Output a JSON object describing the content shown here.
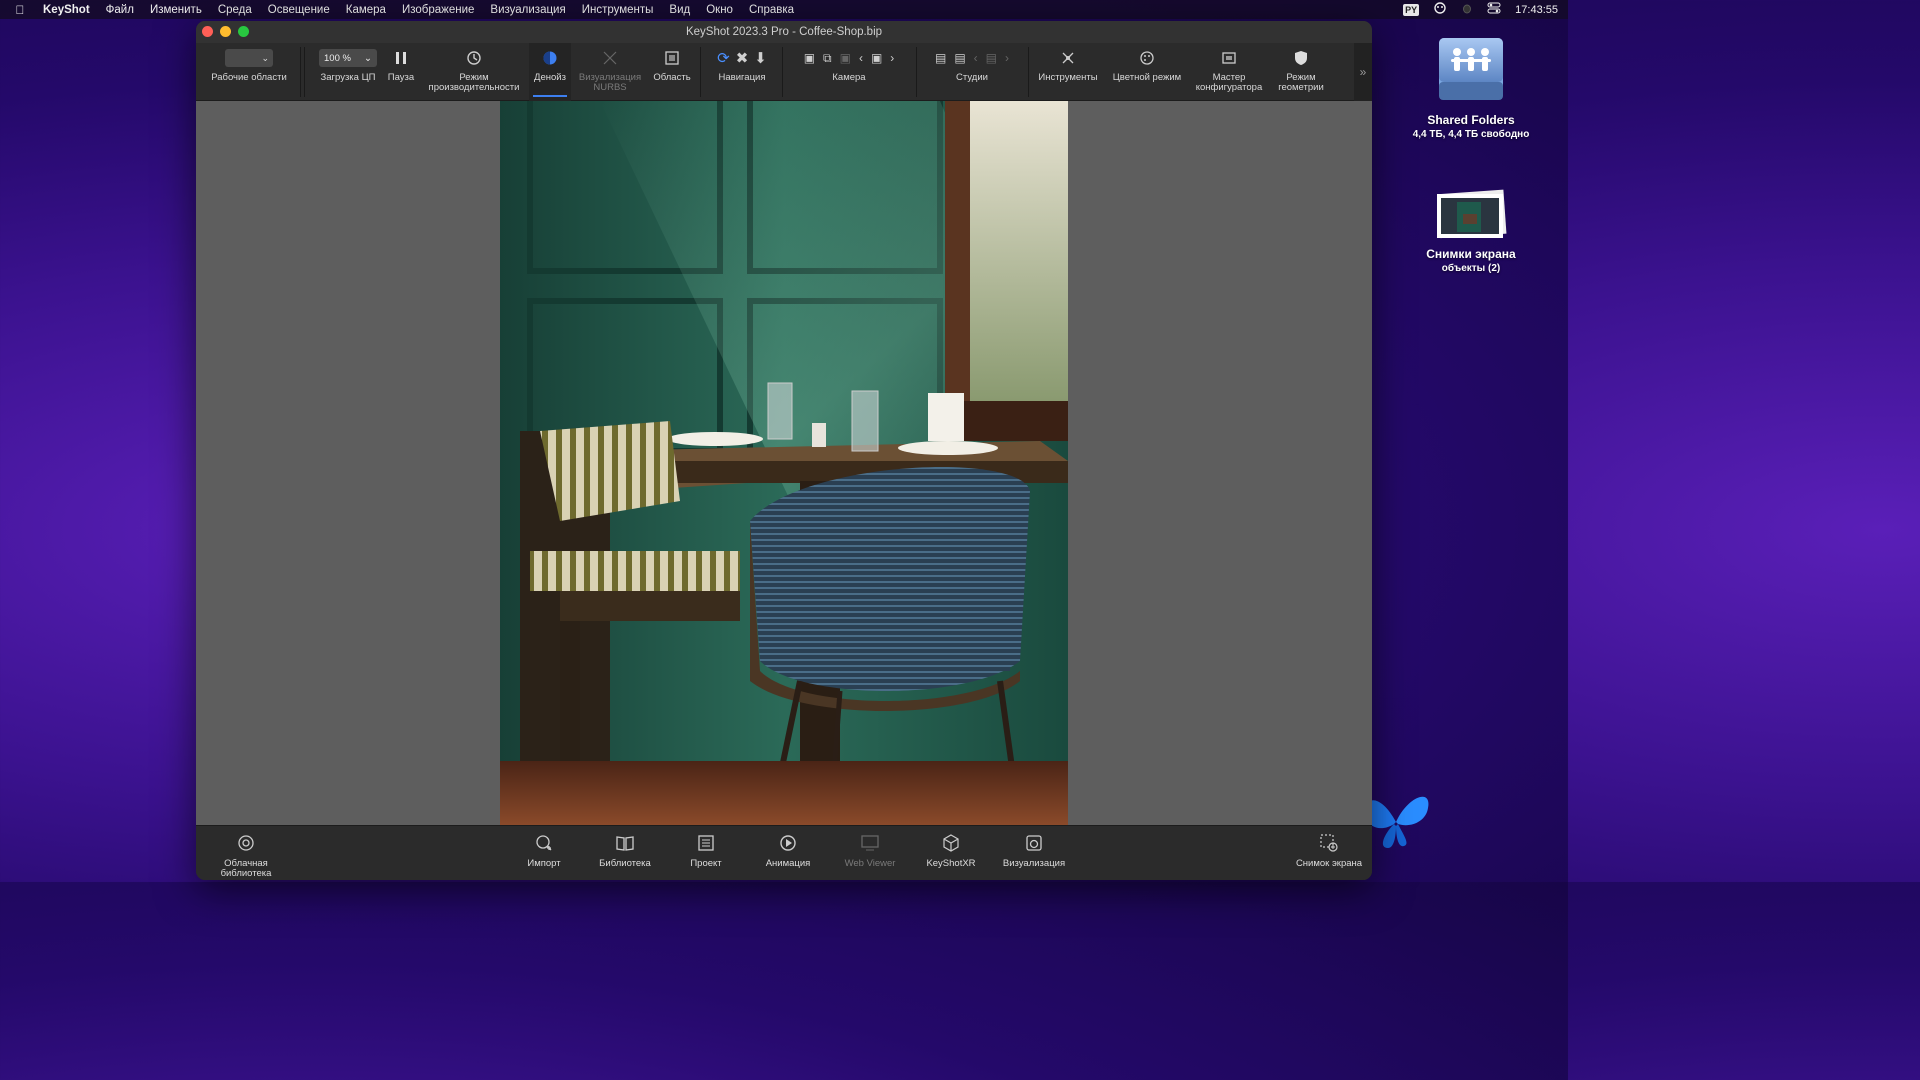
{
  "menubar": {
    "app": "KeyShot",
    "items": [
      "Файл",
      "Изменить",
      "Среда",
      "Освещение",
      "Камера",
      "Изображение",
      "Визуализация",
      "Инструменты",
      "Вид",
      "Окно",
      "Справка"
    ],
    "input_source": "PY",
    "clock": "17:43:55"
  },
  "window": {
    "title": "KeyShot 2023.3 Pro  - Coffee-Shop.bip"
  },
  "toolbar": {
    "workspaces_label": "Рабочие области",
    "zoom_value": "100 %",
    "cpu_load_label": "Загрузка ЦП",
    "pause_label": "Пауза",
    "performance_label_1": "Режим",
    "performance_label_2": "производительности",
    "denoise_label": "Денойз",
    "nurbs_label_1": "Визуализация",
    "nurbs_label_2": "NURBS",
    "region_label": "Область",
    "navigation_label": "Навигация",
    "camera_label": "Камера",
    "studios_label": "Студии",
    "tools_label": "Инструменты",
    "color_mode_label": "Цветной режим",
    "configurator_label_1": "Мастер",
    "configurator_label_2": "конфигуратора",
    "geometry_label_1": "Режим",
    "geometry_label_2": "геометрии"
  },
  "bottombar": {
    "cloud_library_1": "Облачная",
    "cloud_library_2": "библиотека",
    "import": "Импорт",
    "library": "Библиотека",
    "project": "Проект",
    "animation": "Анимация",
    "web_viewer": "Web Viewer",
    "keyshotxr": "KeyShotXR",
    "render": "Визуализация",
    "screenshot": "Снимок экрана"
  },
  "desktop": {
    "shared_folders_name": "Shared Folders",
    "shared_folders_sub": "4,4 ТБ, 4,4 ТБ свободно",
    "screenshots_name": "Снимки экрана",
    "screenshots_sub": "объекты (2)"
  },
  "colors": {
    "accent": "#3d7ff0",
    "wall": "#1f5a4c",
    "desktop": "#3b128f"
  }
}
